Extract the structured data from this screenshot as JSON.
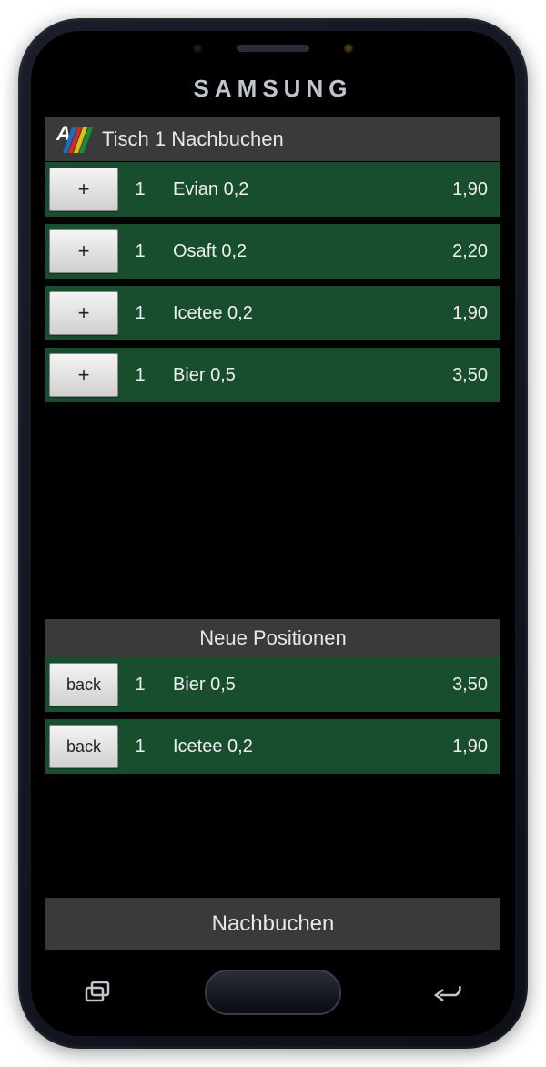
{
  "brand": "SAMSUNG",
  "header": {
    "title": "Tisch 1 Nachbuchen"
  },
  "items": [
    {
      "button": "+",
      "qty": "1",
      "name": "Evian 0,2",
      "price": "1,90"
    },
    {
      "button": "+",
      "qty": "1",
      "name": "Osaft  0,2",
      "price": "2,20"
    },
    {
      "button": "+",
      "qty": "1",
      "name": "Icetee 0,2",
      "price": "1,90"
    },
    {
      "button": "+",
      "qty": "1",
      "name": "Bier 0,5",
      "price": "3,50"
    }
  ],
  "section2": {
    "title": "Neue Positionen"
  },
  "new_items": [
    {
      "button": "back",
      "qty": "1",
      "name": "Bier 0,5",
      "price": "3,50"
    },
    {
      "button": "back",
      "qty": "1",
      "name": "Icetee 0,2",
      "price": "1,90"
    }
  ],
  "footer": {
    "label": "Nachbuchen"
  }
}
